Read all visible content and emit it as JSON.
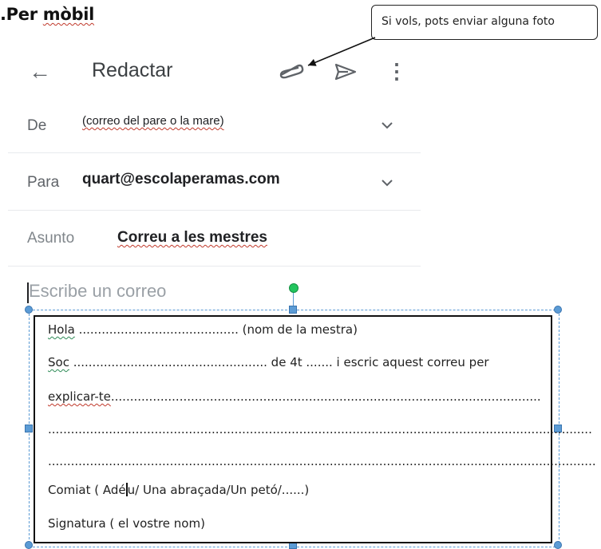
{
  "heading": {
    "prefix": ".Per ",
    "word": "mòbil"
  },
  "callout": {
    "text": "Si vols, pots enviar alguna foto"
  },
  "toolbar": {
    "title": "Redactar",
    "back_icon": "arrow-back-icon",
    "attach_icon": "paperclip-icon",
    "send_icon": "send-icon",
    "more_icon": "more-vert-icon"
  },
  "fields": {
    "from": {
      "label": "De",
      "value": "(correo del pare o la mare)"
    },
    "to": {
      "label": "Para",
      "value": "quart@escolaperamas.com"
    },
    "subject": {
      "label": "Asunto",
      "value": "Correu a les mestres"
    }
  },
  "compose": {
    "placeholder": "Escribe un correo"
  },
  "template_box": {
    "line1": {
      "start": "Hola",
      "dots": " ..........................................",
      "end": " (nom de la mestra)"
    },
    "line2": {
      "start": "Soc",
      "dots": " ...................................................",
      "mid": " de 4t ....... i escric aquest correu per"
    },
    "line3": {
      "start": "explicar-te",
      "dots": "................................................................................................................."
    },
    "line4": {
      "dots": "..............................................................................................................................................."
    },
    "line5": {
      "dots": "................................................................................................................................................"
    },
    "line6": {
      "pre": "Comiat ( Adé",
      "post": "u/ Una abraçada/Un petó/......)"
    },
    "line7": {
      "text": "Signatura ( el vostre nom)"
    }
  },
  "colors": {
    "selection": "#5b9bd5",
    "rotate_handle": "#22c55e",
    "icon": "#5f6368"
  }
}
